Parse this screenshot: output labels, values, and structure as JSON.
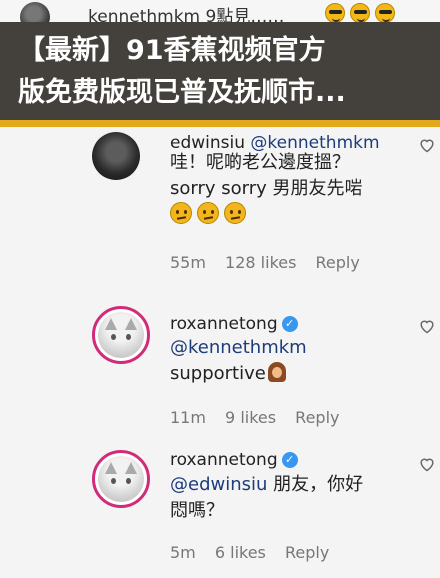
{
  "top": {
    "username": "kennethmkm",
    "text": "9點見……"
  },
  "banner": {
    "line1": "【最新】91香蕉视频官方",
    "line2": "版免费版现已普及抚顺市..."
  },
  "comments": [
    {
      "username": "edwinsiu",
      "mention": "@kennethmkm",
      "line1": "哇！呢啲老公邊度搵？",
      "line2": "sorry sorry 男朋友先啱",
      "time": "55m",
      "likes": "128 likes",
      "reply": "Reply"
    },
    {
      "username": "roxannetong",
      "line1": "@kennethmkm",
      "line2": "supportive",
      "time": "11m",
      "likes": "9 likes",
      "reply": "Reply"
    },
    {
      "username": "roxannetong",
      "line1_mention": "@edwinsiu",
      "line1_text": " 朋友，你好",
      "line2": "悶嗎？",
      "time": "5m",
      "likes": "6 likes",
      "reply": "Reply"
    }
  ],
  "icons": {
    "heart": "heart-outline-icon",
    "verified": "verified-badge-icon",
    "emoji_sunglasses": "sunglasses-emoji-icon",
    "emoji_thinking": "thinking-emoji-icon",
    "emoji_woman": "woman-emoji-icon"
  },
  "colors": {
    "banner_bg": "#44403b",
    "banner_accent": "#e3a91c",
    "verified": "#3897f0",
    "avatar_ring": "#d12b7a"
  }
}
